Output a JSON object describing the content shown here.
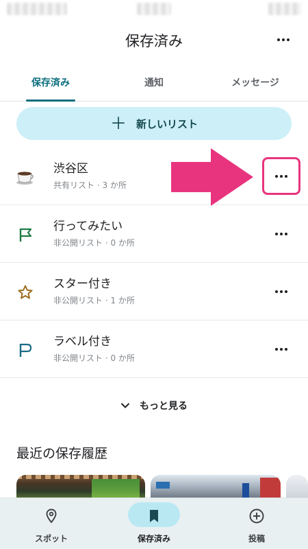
{
  "header": {
    "title": "保存済み",
    "more_icon": "more-horiz-icon"
  },
  "tabs": [
    {
      "label": "保存済み",
      "active": true
    },
    {
      "label": "通知",
      "active": false
    },
    {
      "label": "メッセージ",
      "active": false
    }
  ],
  "new_list": {
    "icon": "plus-icon",
    "label": "新しいリスト"
  },
  "lists": [
    {
      "name": "渋谷区",
      "meta": "共有リスト · 3 か所",
      "icon": "coffee-cup-icon"
    },
    {
      "name": "行ってみたい",
      "meta": "非公開リスト · 0 か所",
      "icon": "flag-icon"
    },
    {
      "name": "スター付き",
      "meta": "非公開リスト · 1 か所",
      "icon": "star-icon"
    },
    {
      "name": "ラベル付き",
      "meta": "非公開リスト · 0 か所",
      "icon": "label-flag-icon"
    }
  ],
  "see_more": {
    "label": "もっと見る",
    "icon": "chevron-down-icon"
  },
  "recent": {
    "title": "最近の保存履歴"
  },
  "bottom_nav": [
    {
      "label": "スポット",
      "icon": "location-pin-icon",
      "active": false
    },
    {
      "label": "保存済み",
      "icon": "bookmark-icon",
      "active": true
    },
    {
      "label": "投稿",
      "icon": "add-circle-icon",
      "active": false
    }
  ],
  "colors": {
    "accent": "#0b6e7d",
    "new_list_bg": "#cdeff8",
    "annotation": "#e8347f",
    "flag_green": "#1e7b45",
    "star_brown": "#9a6a17",
    "label_teal": "#1b6b86"
  }
}
